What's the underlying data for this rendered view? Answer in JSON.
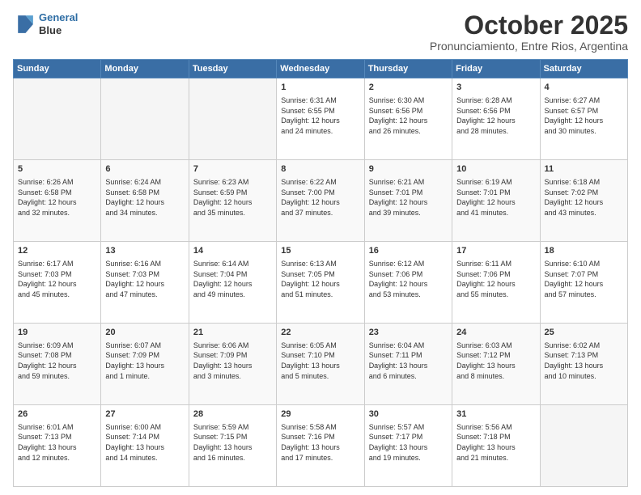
{
  "header": {
    "logo_line1": "General",
    "logo_line2": "Blue",
    "month": "October 2025",
    "location": "Pronunciamiento, Entre Rios, Argentina"
  },
  "weekdays": [
    "Sunday",
    "Monday",
    "Tuesday",
    "Wednesday",
    "Thursday",
    "Friday",
    "Saturday"
  ],
  "weeks": [
    [
      {
        "day": "",
        "info": ""
      },
      {
        "day": "",
        "info": ""
      },
      {
        "day": "",
        "info": ""
      },
      {
        "day": "1",
        "info": "Sunrise: 6:31 AM\nSunset: 6:55 PM\nDaylight: 12 hours\nand 24 minutes."
      },
      {
        "day": "2",
        "info": "Sunrise: 6:30 AM\nSunset: 6:56 PM\nDaylight: 12 hours\nand 26 minutes."
      },
      {
        "day": "3",
        "info": "Sunrise: 6:28 AM\nSunset: 6:56 PM\nDaylight: 12 hours\nand 28 minutes."
      },
      {
        "day": "4",
        "info": "Sunrise: 6:27 AM\nSunset: 6:57 PM\nDaylight: 12 hours\nand 30 minutes."
      }
    ],
    [
      {
        "day": "5",
        "info": "Sunrise: 6:26 AM\nSunset: 6:58 PM\nDaylight: 12 hours\nand 32 minutes."
      },
      {
        "day": "6",
        "info": "Sunrise: 6:24 AM\nSunset: 6:58 PM\nDaylight: 12 hours\nand 34 minutes."
      },
      {
        "day": "7",
        "info": "Sunrise: 6:23 AM\nSunset: 6:59 PM\nDaylight: 12 hours\nand 35 minutes."
      },
      {
        "day": "8",
        "info": "Sunrise: 6:22 AM\nSunset: 7:00 PM\nDaylight: 12 hours\nand 37 minutes."
      },
      {
        "day": "9",
        "info": "Sunrise: 6:21 AM\nSunset: 7:01 PM\nDaylight: 12 hours\nand 39 minutes."
      },
      {
        "day": "10",
        "info": "Sunrise: 6:19 AM\nSunset: 7:01 PM\nDaylight: 12 hours\nand 41 minutes."
      },
      {
        "day": "11",
        "info": "Sunrise: 6:18 AM\nSunset: 7:02 PM\nDaylight: 12 hours\nand 43 minutes."
      }
    ],
    [
      {
        "day": "12",
        "info": "Sunrise: 6:17 AM\nSunset: 7:03 PM\nDaylight: 12 hours\nand 45 minutes."
      },
      {
        "day": "13",
        "info": "Sunrise: 6:16 AM\nSunset: 7:03 PM\nDaylight: 12 hours\nand 47 minutes."
      },
      {
        "day": "14",
        "info": "Sunrise: 6:14 AM\nSunset: 7:04 PM\nDaylight: 12 hours\nand 49 minutes."
      },
      {
        "day": "15",
        "info": "Sunrise: 6:13 AM\nSunset: 7:05 PM\nDaylight: 12 hours\nand 51 minutes."
      },
      {
        "day": "16",
        "info": "Sunrise: 6:12 AM\nSunset: 7:06 PM\nDaylight: 12 hours\nand 53 minutes."
      },
      {
        "day": "17",
        "info": "Sunrise: 6:11 AM\nSunset: 7:06 PM\nDaylight: 12 hours\nand 55 minutes."
      },
      {
        "day": "18",
        "info": "Sunrise: 6:10 AM\nSunset: 7:07 PM\nDaylight: 12 hours\nand 57 minutes."
      }
    ],
    [
      {
        "day": "19",
        "info": "Sunrise: 6:09 AM\nSunset: 7:08 PM\nDaylight: 12 hours\nand 59 minutes."
      },
      {
        "day": "20",
        "info": "Sunrise: 6:07 AM\nSunset: 7:09 PM\nDaylight: 13 hours\nand 1 minute."
      },
      {
        "day": "21",
        "info": "Sunrise: 6:06 AM\nSunset: 7:09 PM\nDaylight: 13 hours\nand 3 minutes."
      },
      {
        "day": "22",
        "info": "Sunrise: 6:05 AM\nSunset: 7:10 PM\nDaylight: 13 hours\nand 5 minutes."
      },
      {
        "day": "23",
        "info": "Sunrise: 6:04 AM\nSunset: 7:11 PM\nDaylight: 13 hours\nand 6 minutes."
      },
      {
        "day": "24",
        "info": "Sunrise: 6:03 AM\nSunset: 7:12 PM\nDaylight: 13 hours\nand 8 minutes."
      },
      {
        "day": "25",
        "info": "Sunrise: 6:02 AM\nSunset: 7:13 PM\nDaylight: 13 hours\nand 10 minutes."
      }
    ],
    [
      {
        "day": "26",
        "info": "Sunrise: 6:01 AM\nSunset: 7:13 PM\nDaylight: 13 hours\nand 12 minutes."
      },
      {
        "day": "27",
        "info": "Sunrise: 6:00 AM\nSunset: 7:14 PM\nDaylight: 13 hours\nand 14 minutes."
      },
      {
        "day": "28",
        "info": "Sunrise: 5:59 AM\nSunset: 7:15 PM\nDaylight: 13 hours\nand 16 minutes."
      },
      {
        "day": "29",
        "info": "Sunrise: 5:58 AM\nSunset: 7:16 PM\nDaylight: 13 hours\nand 17 minutes."
      },
      {
        "day": "30",
        "info": "Sunrise: 5:57 AM\nSunset: 7:17 PM\nDaylight: 13 hours\nand 19 minutes."
      },
      {
        "day": "31",
        "info": "Sunrise: 5:56 AM\nSunset: 7:18 PM\nDaylight: 13 hours\nand 21 minutes."
      },
      {
        "day": "",
        "info": ""
      }
    ]
  ]
}
